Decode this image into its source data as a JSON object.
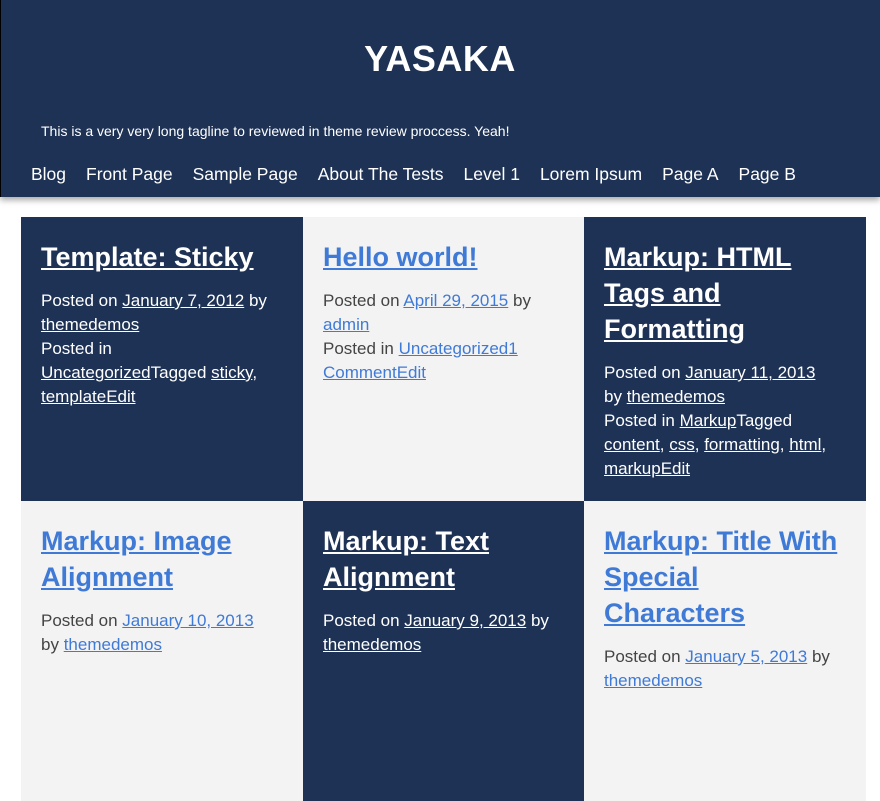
{
  "site": {
    "title": "YASAKA",
    "tagline": "This is a very very long tagline to reviewed in theme review proccess. Yeah!"
  },
  "nav": [
    "Blog",
    "Front Page",
    "Sample Page",
    "About The Tests",
    "Level 1",
    "Lorem Ipsum",
    "Page A",
    "Page B"
  ],
  "labels": {
    "posted_on": "Posted on",
    "by": "by",
    "posted_in": "Posted in",
    "tagged": "Tagged",
    "comma": ","
  },
  "posts": [
    {
      "title": "Template: Sticky",
      "date": "January 7, 2012",
      "author": "themedemos",
      "category": "Uncategorized",
      "tags": [
        "sticky",
        "template"
      ],
      "edit": "Edit"
    },
    {
      "title": "Hello world!",
      "date": "April 29, 2015",
      "author": "admin",
      "category": "Uncategorized",
      "comments": "1 Comment",
      "edit": "Edit"
    },
    {
      "title": "Markup: HTML Tags and Formatting",
      "date": "January 11, 2013",
      "author": "themedemos",
      "category": "Markup",
      "tags": [
        "content",
        "css",
        "formatting",
        "html",
        "markup"
      ],
      "edit": "Edit"
    },
    {
      "title": "Markup: Image Alignment",
      "date": "January 10, 2013",
      "author": "themedemos"
    },
    {
      "title": "Markup: Text Alignment",
      "date": "January 9, 2013",
      "author": "themedemos"
    },
    {
      "title": "Markup: Title With Special Characters",
      "date": "January 5, 2013",
      "author": "themedemos"
    }
  ],
  "colors": {
    "header_bg": "#1e3255",
    "card_dark": "#1e3255",
    "card_light": "#f3f3f3",
    "link_blue": "#3f7ad6"
  }
}
